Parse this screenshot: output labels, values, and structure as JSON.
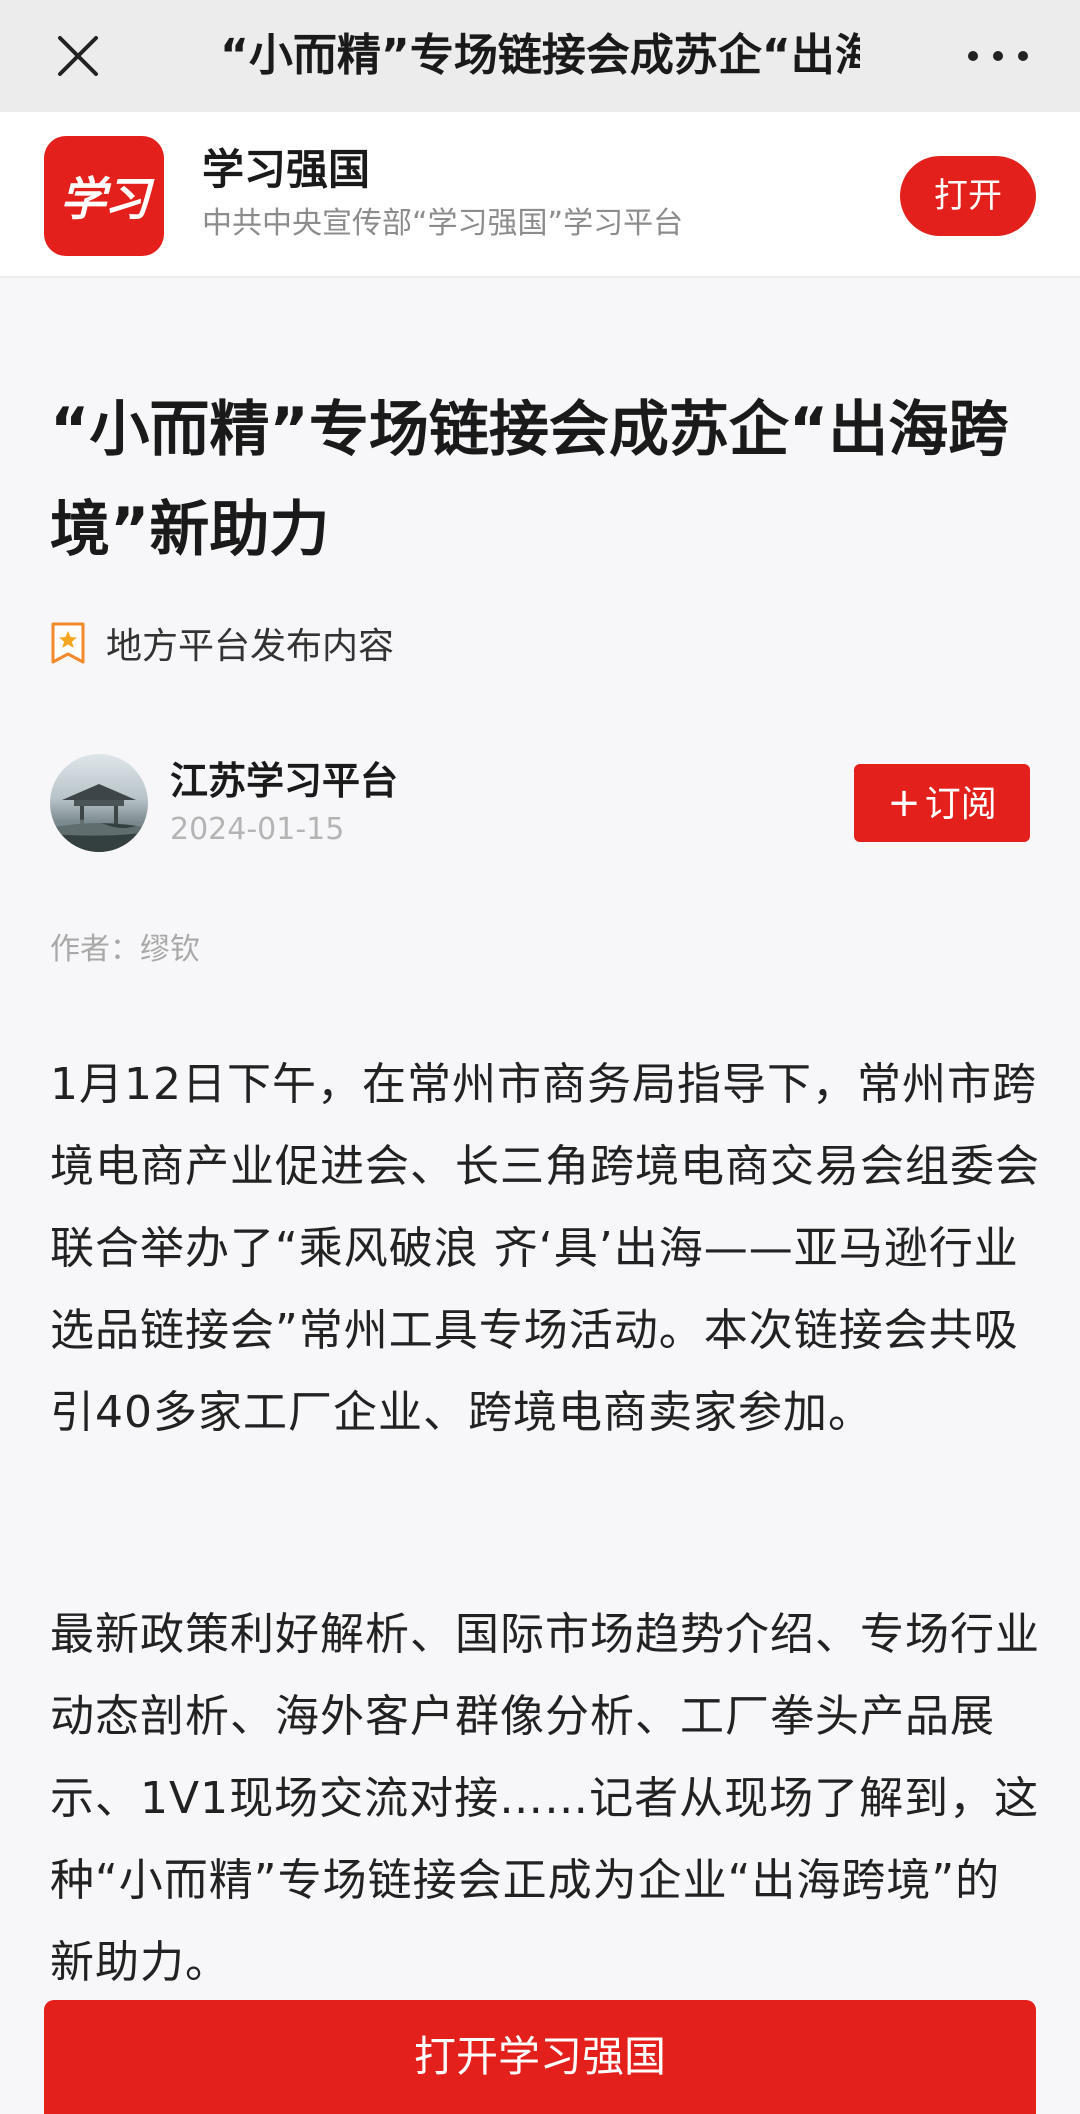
{
  "navbar": {
    "title": "“小而精”专场链接会成苏企“出海跨境”新助力",
    "close_icon": "close-icon",
    "more_icon": "more-dots-icon"
  },
  "app_banner": {
    "logo_text": "学习",
    "app_name": "学习强国",
    "description": "中共中央宣传部“学习强国”学习平台",
    "open_label": "打开"
  },
  "article": {
    "title": "“小而精”专场链接会成苏企“出海跨境”新助力",
    "platform_tag": "地方平台发布内容",
    "source_name": "江苏学习平台",
    "publish_date": "2024-01-15",
    "subscribe_plus": "+",
    "subscribe_label": "订阅",
    "author": "作者：缪钦",
    "paragraphs": [
      "1月12日下午，在常州市商务局指导下，常州市跨境电商产业促进会、长三角跨境电商交易会组委会联合举办了“乘风破浪 齐‘具’出海——亚马逊行业选品链接会”常州工具专场活动。本次链接会共吸引40多家工厂企业、跨境电商卖家参加。",
      "最新政策利好解析、国际市场趋势介绍、专场行业动态剖析、海外客户群像分析、工厂拳头产品展示、1V1现场交流对接……记者从现场了解到，这种“小而精”专场链接会正成为企业“出海跨境”的新助力。"
    ]
  },
  "cta": {
    "label": "打开学习强国"
  },
  "colors": {
    "brand_red": "#e3201b",
    "topbar_bg": "#ececec",
    "page_bg": "#f7f7f9",
    "muted_text": "#a8a8a8"
  }
}
